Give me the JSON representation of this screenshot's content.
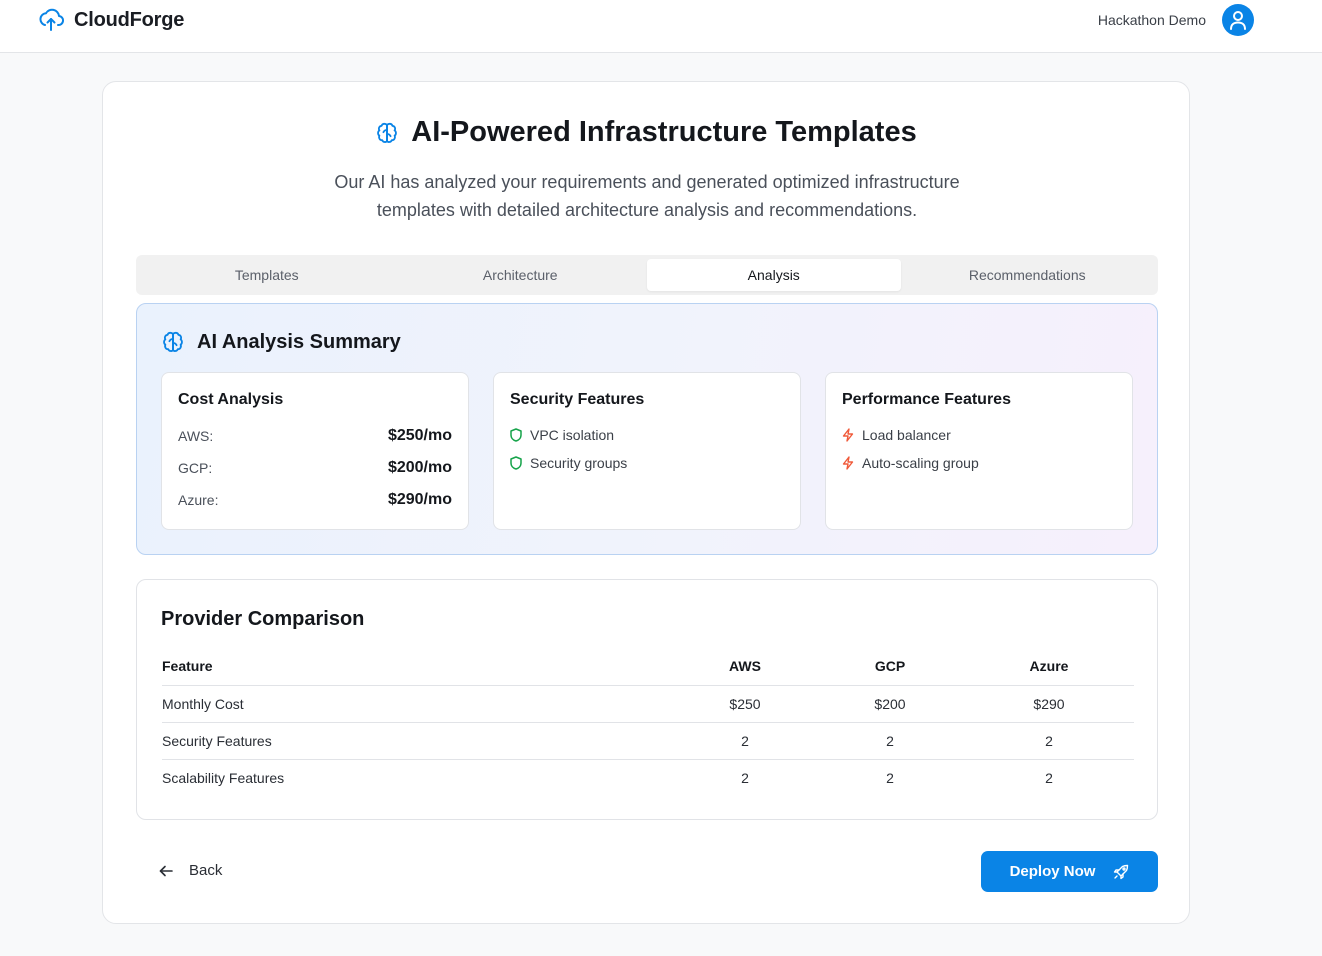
{
  "app": {
    "name": "CloudForge",
    "user_name": "Hackathon Demo"
  },
  "page": {
    "title": "AI-Powered Infrastructure Templates",
    "subtitle": "Our AI has analyzed your requirements and generated optimized infrastructure templates with detailed architecture analysis and recommendations."
  },
  "tabs": [
    {
      "label": "Templates",
      "active": false
    },
    {
      "label": "Architecture",
      "active": false
    },
    {
      "label": "Analysis",
      "active": true
    },
    {
      "label": "Recommendations",
      "active": false
    }
  ],
  "summary": {
    "title": "AI Analysis Summary",
    "cost": {
      "title": "Cost Analysis",
      "rows": [
        {
          "label": "AWS:",
          "value": "$250/mo"
        },
        {
          "label": "GCP:",
          "value": "$200/mo"
        },
        {
          "label": "Azure:",
          "value": "$290/mo"
        }
      ]
    },
    "security": {
      "title": "Security Features",
      "items": [
        "VPC isolation",
        "Security groups"
      ]
    },
    "performance": {
      "title": "Performance Features",
      "items": [
        "Load balancer",
        "Auto-scaling group"
      ]
    }
  },
  "comparison": {
    "title": "Provider Comparison",
    "headers": [
      "Feature",
      "AWS",
      "GCP",
      "Azure"
    ],
    "rows": [
      [
        "Monthly Cost",
        "$250",
        "$200",
        "$290"
      ],
      [
        "Security Features",
        "2",
        "2",
        "2"
      ],
      [
        "Scalability Features",
        "2",
        "2",
        "2"
      ]
    ]
  },
  "actions": {
    "back_label": "Back",
    "deploy_label": "Deploy Now"
  },
  "icons": {
    "brand": "cloud-upload-icon",
    "avatar": "user-icon",
    "title": "brain-icon",
    "summary": "brain-icon",
    "security": "shield-icon",
    "performance": "zap-icon",
    "back": "arrow-left-icon",
    "deploy": "rocket-icon"
  },
  "colors": {
    "accent": "#0a84e6",
    "security": "#16a34a",
    "performance": "#f05a3a"
  }
}
